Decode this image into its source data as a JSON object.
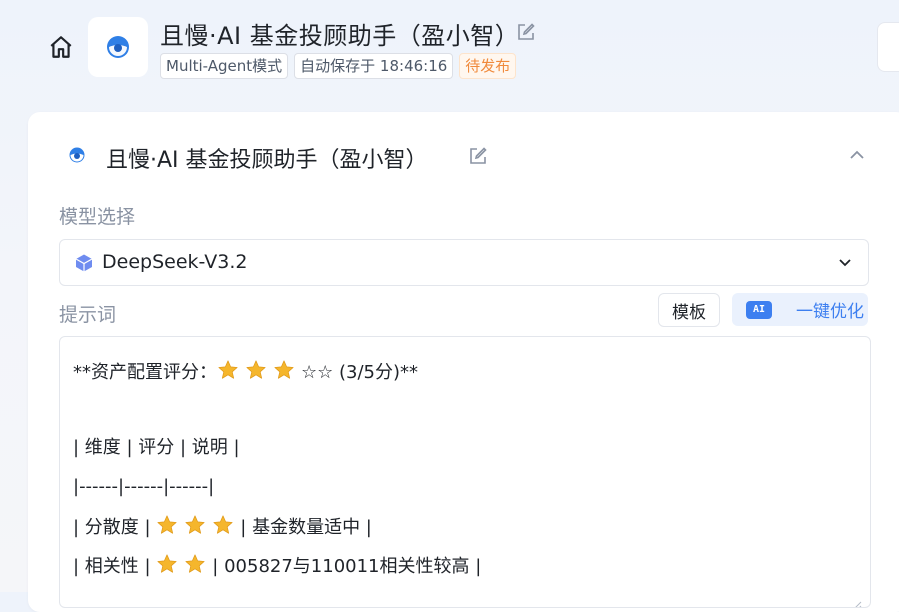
{
  "header": {
    "title": "且慢·AI 基金投顾助手（盈小智）",
    "mode_tag": "Multi-Agent模式",
    "autosave": "自动保存于 18:46:16",
    "status": "待发布"
  },
  "agent": {
    "title": "且慢·AI 基金投顾助手（盈小智）"
  },
  "model": {
    "label": "模型选择",
    "selected": "DeepSeek-V3.2"
  },
  "prompt": {
    "label": "提示词",
    "template_button": "模板",
    "ai_badge": "AI",
    "optimize_button": "一键优化",
    "lines": {
      "l1_pre": "**资产配置评分：",
      "l1_post": "☆☆ (3/5分)**",
      "l2": "| 维度 | 评分 | 说明 |",
      "l3": "|------|------|------|",
      "l4_pre": "| 分散度 | ",
      "l4_post": "| 基金数量适中 |",
      "l5_pre": "| 相关性 | ",
      "l5_post": "| 005827与110011相关性较高 |"
    },
    "scores": {
      "overall_stars_filled": 3,
      "diversification_stars": 3,
      "correlation_stars": 2
    }
  },
  "colors": {
    "accent": "#3d7ff0",
    "status": "#f08a3c",
    "star": "#f5b62c"
  },
  "icons": [
    "home-icon",
    "app-logo-icon",
    "edit-icon",
    "chevron-up-icon",
    "cube-icon",
    "chevron-down-icon",
    "ai-badge-icon",
    "star-icon"
  ]
}
